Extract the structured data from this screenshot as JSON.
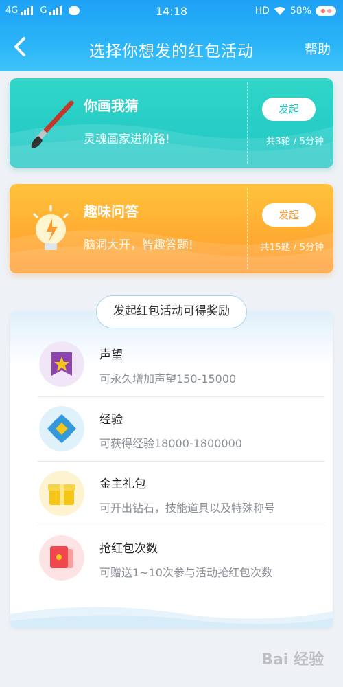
{
  "status": {
    "network1": "4G",
    "network2": "G",
    "time": "14:18",
    "hd": "HD",
    "battery": "58%"
  },
  "nav": {
    "title": "选择你想发的红包活动",
    "help": "帮助"
  },
  "activities": [
    {
      "title": "你画我猜",
      "desc": "灵魂画家进阶路!",
      "button": "发起",
      "meta": "共3轮 / 5分钟",
      "icon": "paintbrush-icon",
      "color": "#22c3c6"
    },
    {
      "title": "趣味问答",
      "desc": "脑洞大开，智趣答题!",
      "button": "发起",
      "meta": "共15题 / 5分钟",
      "icon": "lightbulb-icon",
      "color": "#ff9a2e"
    }
  ],
  "rewards": {
    "header": "发起红包活动可得奖励",
    "items": [
      {
        "title": "声望",
        "desc": "可永久增加声望150-15000",
        "icon": "reputation-banner-icon"
      },
      {
        "title": "经验",
        "desc": "可获得经验18000-1800000",
        "icon": "experience-gem-icon"
      },
      {
        "title": "金主礼包",
        "desc": "可开出钻石，技能道具以及特殊称号",
        "icon": "gift-box-icon"
      },
      {
        "title": "抢红包次数",
        "desc": "可赠送1~10次参与活动抢红包次数",
        "icon": "red-envelope-icon"
      }
    ]
  },
  "watermark": "Bai 经验"
}
